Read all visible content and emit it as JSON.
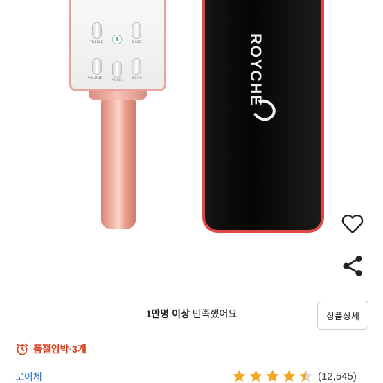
{
  "product_image": {
    "mic_labels": [
      "TREBLE",
      "BASS",
      "VOLUME",
      "ECHO",
      "MUSIC"
    ],
    "case_brand": "ROYCHE"
  },
  "actions": {
    "wishlist_icon": "heart-outline-icon",
    "share_icon": "share-icon"
  },
  "satisfaction": {
    "strong": "1만명 이상",
    "rest": " 만족했어요"
  },
  "detail_button_label": "상품상세",
  "stock": {
    "icon": "alarm-clock-icon",
    "text": "품절임박·3개",
    "color": "#d8401d"
  },
  "seller_name": "로이체",
  "rating": {
    "stars": 4.5,
    "max": 5,
    "review_count": "(12,545)",
    "star_color": "#f5a623"
  }
}
